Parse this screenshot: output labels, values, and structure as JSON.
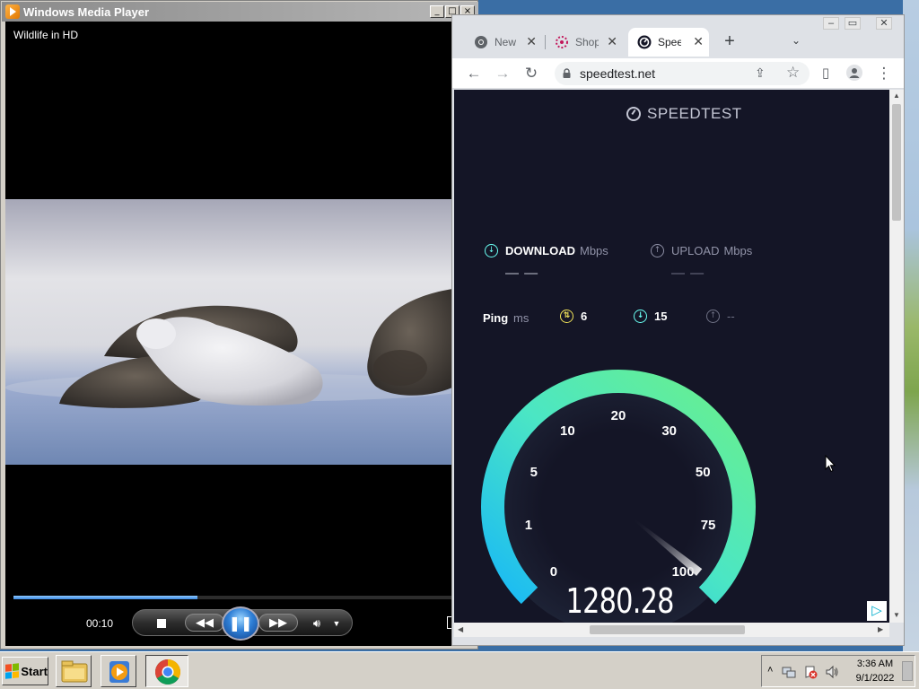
{
  "wmp": {
    "title": "Windows Media Player",
    "now_playing": "Wildlife in HD",
    "elapsed": "00:10",
    "seek_progress": 0.42,
    "caption_min": "_",
    "caption_max": "□",
    "caption_close": "×"
  },
  "chrome": {
    "tabs": [
      {
        "label": "New T",
        "favicon": "chrome-icon",
        "active": false
      },
      {
        "label": "Shopp",
        "favicon": "shopping-icon",
        "active": false
      },
      {
        "label": "Speed",
        "favicon": "speedtest-icon",
        "active": true
      }
    ],
    "tab_close": "✕",
    "new_tab": "+",
    "tab_search": "⌄",
    "url": "speedtest.net",
    "back": "←",
    "forward": "→",
    "reload": "↻",
    "share": "⇪",
    "star": "☆",
    "side_panel": "▯",
    "menu": "⋮",
    "caption_min": "–",
    "caption_max": "▭",
    "caption_close": "✕"
  },
  "speedtest": {
    "logo": "SPEEDTEST",
    "download_label": "DOWNLOAD",
    "download_unit": "Mbps",
    "download_value": "— —",
    "upload_label": "UPLOAD",
    "upload_unit": "Mbps",
    "upload_value": "— —",
    "ping_label": "Ping",
    "ping_unit": "ms",
    "ping_idle": "6",
    "ping_download": "15",
    "ping_upload": "--",
    "gauge_value": "1280.28",
    "gauge_ticks": [
      "0",
      "1",
      "5",
      "10",
      "20",
      "30",
      "50",
      "75",
      "100"
    ],
    "gauge_max_reading": 100,
    "colors": {
      "background": "#141526",
      "gauge_start": "#19b9f5",
      "gauge_end": "#6bf08a",
      "text_dim": "#9193a8"
    }
  },
  "taskbar": {
    "start_label": "Start",
    "time": "3:36 AM",
    "date": "9/1/2022",
    "tray_chevron": "˄"
  }
}
